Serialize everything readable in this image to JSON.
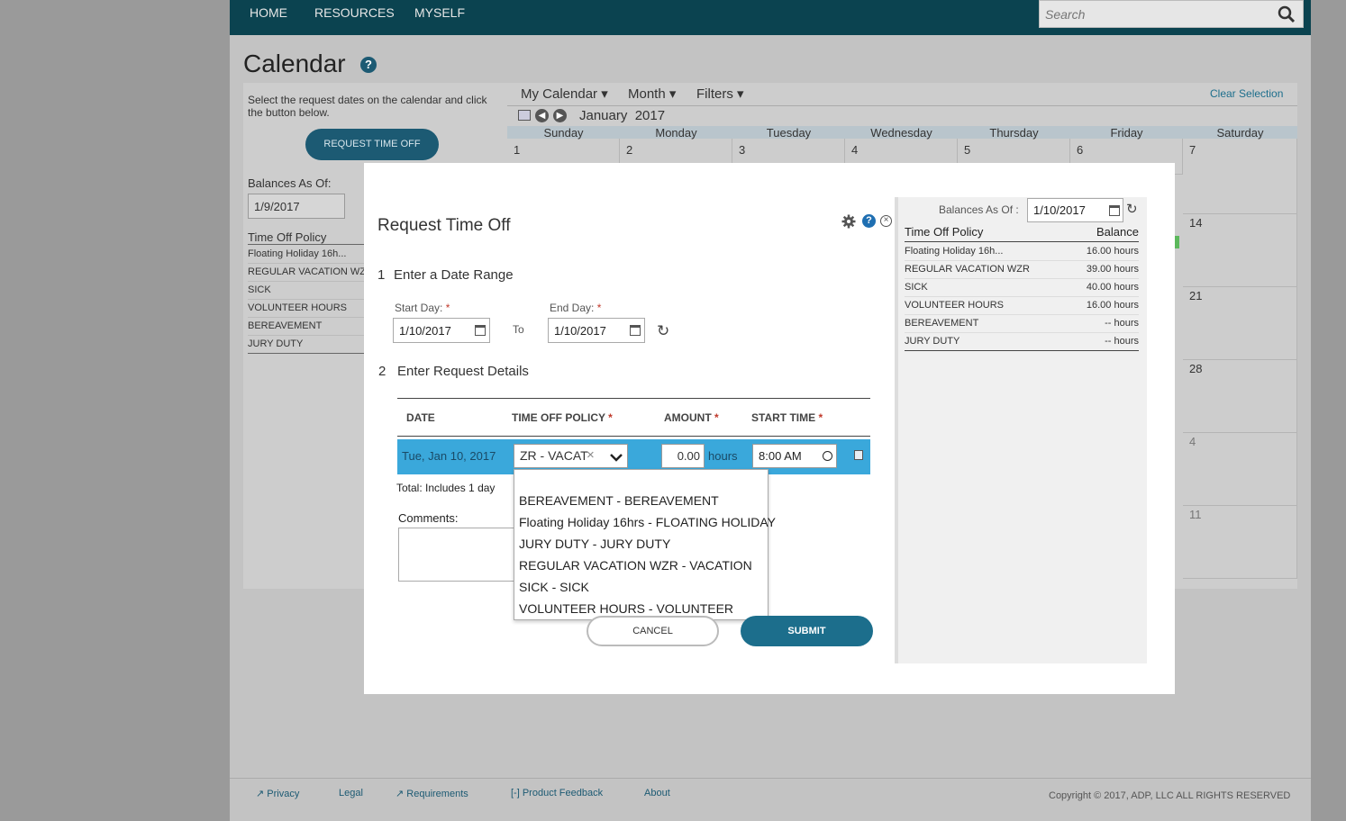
{
  "nav": {
    "items": [
      "HOME",
      "RESOURCES",
      "MYSELF"
    ],
    "search_placeholder": "Search"
  },
  "background": {
    "page_title": "Calendar",
    "instructions": "Select the request dates on the calendar and click the button below.",
    "request_button": "REQUEST TIME OFF",
    "balances_label": "Balances As Of:",
    "balances_date": "1/9/2017",
    "policy_header": "Time Off Policy",
    "policies": [
      "Floating Holiday 16h...",
      "REGULAR VACATION WZ",
      "SICK",
      "VOLUNTEER HOURS",
      "BEREAVEMENT",
      "JURY DUTY"
    ],
    "calendar": {
      "my_calendar": "My Calendar",
      "month": "Month",
      "filters": "Filters",
      "clear_selection": "Clear Selection",
      "month_label": "January",
      "year_label": "2017",
      "days": [
        "Sunday",
        "Monday",
        "Tuesday",
        "Wednesday",
        "Thursday",
        "Friday",
        "Saturday"
      ],
      "first_row": [
        "1",
        "2",
        "3",
        "4",
        "5",
        "6",
        "7"
      ],
      "saturday_col": [
        "14",
        "21",
        "28",
        "4",
        "11"
      ]
    }
  },
  "modal": {
    "title": "Request Time Off",
    "step1": {
      "num": "1",
      "label": "Enter a Date Range"
    },
    "start_label": "Start Day:",
    "end_label": "End Day:",
    "required_mark": "*",
    "start_value": "1/10/2017",
    "to_label": "To",
    "end_value": "1/10/2017",
    "step2": {
      "num": "2",
      "label": "Enter Request Details"
    },
    "table_headers": {
      "date": "DATE",
      "policy": "TIME OFF POLICY",
      "amount": "AMOUNT",
      "start_time": "START TIME"
    },
    "row": {
      "date": "Tue, Jan 10, 2017",
      "policy": "ZR - VACAT",
      "amount": "0.00",
      "unit": "hours",
      "start_time": "8:00 AM"
    },
    "total_label": "Total:",
    "total_value": "Includes 1 day",
    "comments_label": "Comments:",
    "dropdown_options": [
      "BEREAVEMENT - BEREAVEMENT",
      "Floating Holiday 16hrs - FLOATING HOLIDAY",
      "JURY DUTY - JURY DUTY",
      "REGULAR VACATION WZR - VACATION",
      "SICK - SICK",
      "VOLUNTEER HOURS - VOLUNTEER"
    ],
    "cancel": "CANCEL",
    "submit": "SUBMIT",
    "balances": {
      "label": "Balances As Of :",
      "date": "1/10/2017",
      "col_policy": "Time Off Policy",
      "col_balance": "Balance",
      "rows": [
        {
          "policy": "Floating Holiday 16h...",
          "balance": "16.00 hours"
        },
        {
          "policy": "REGULAR VACATION WZR",
          "balance": "39.00 hours"
        },
        {
          "policy": "SICK",
          "balance": "40.00 hours"
        },
        {
          "policy": "VOLUNTEER HOURS",
          "balance": "16.00 hours"
        },
        {
          "policy": "BEREAVEMENT",
          "balance": "-- hours"
        },
        {
          "policy": "JURY DUTY",
          "balance": "-- hours"
        }
      ]
    }
  },
  "footer": {
    "privacy": "Privacy",
    "legal": "Legal",
    "requirements": "Requirements",
    "feedback": "Product Feedback",
    "about": "About",
    "copyright": "Copyright © 2017, ADP, LLC ALL RIGHTS RESERVED"
  },
  "colors": {
    "nav": "#0b4350",
    "accent": "#1c6e8c",
    "row_highlight": "#3aa8db"
  }
}
